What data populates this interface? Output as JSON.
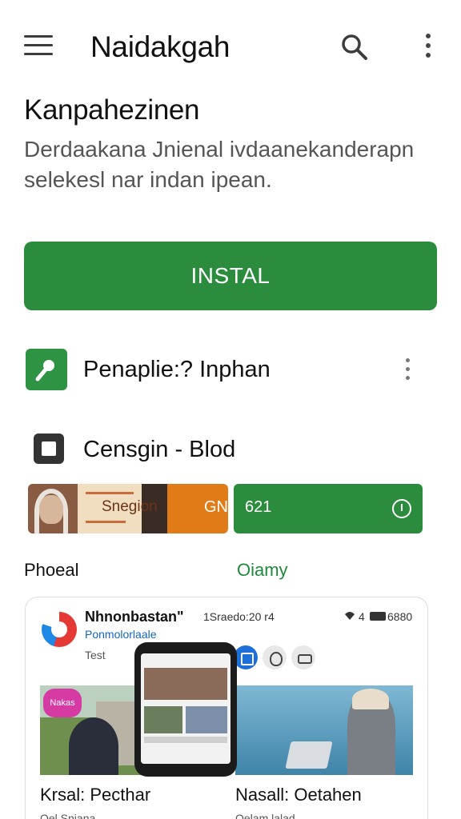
{
  "appbar": {
    "title": "Naidakgah",
    "menu_icon": "hamburger-menu-icon",
    "search_icon": "search-icon",
    "more_icon": "more-vert-icon"
  },
  "header": {
    "heading": "Kanpahezinen",
    "description": "Derdaakana Jnienal ivdaanekanderapn selekesl nar indan ipean."
  },
  "install": {
    "label": "INSTAL",
    "color": "#2b8c3e"
  },
  "rows": [
    {
      "label": "Penaplie:? Inphan",
      "icon": "microphone-app-icon"
    },
    {
      "label": "Censgin - Blod",
      "icon": "square-stop-icon"
    }
  ],
  "promos": {
    "left_label": "Snegion",
    "left_badge": "GNP",
    "right_label": "621",
    "right_icon": "clock-icon"
  },
  "section": {
    "left": "Phoeal",
    "right": "Oiamy",
    "accent": "#1e8a3c"
  },
  "card": {
    "title": "Nhnonbastan\"",
    "subtitle": "Ponmolorlaale",
    "test": "Test",
    "meta": "1Sraedo:20 r4",
    "status": "4",
    "battery": "6880",
    "image_badge": "Nakas",
    "caption_left": "Krsal: Pecthar",
    "caption_right": "Nasall: Oetahen",
    "subcaption_left": "Oel Sniana",
    "subcaption_right": "Oelam lalad"
  }
}
